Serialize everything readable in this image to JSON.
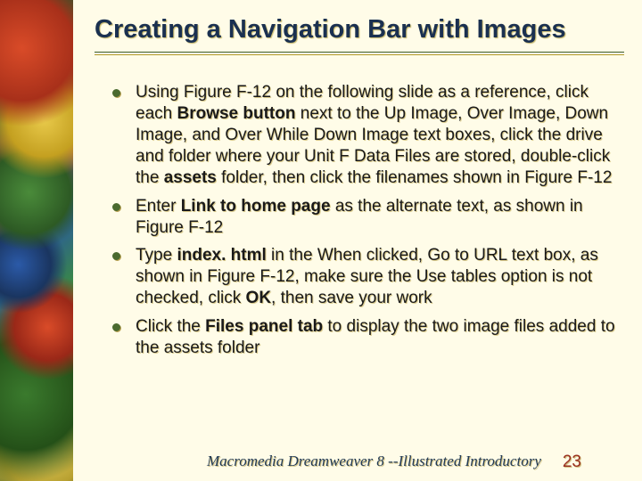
{
  "title": "Creating a Navigation Bar with Images",
  "bullets": [
    {
      "segments": [
        {
          "t": "Using Figure F-12 on the following slide as a reference, click each ",
          "b": false
        },
        {
          "t": "Browse button",
          "b": true
        },
        {
          "t": " next to the Up Image, Over Image, Down Image, and Over While Down Image text boxes, click the drive and folder where your Unit F Data Files are stored, double-click the ",
          "b": false
        },
        {
          "t": "assets",
          "b": true
        },
        {
          "t": " folder, then click the filenames shown in Figure F-12",
          "b": false
        }
      ]
    },
    {
      "segments": [
        {
          "t": "Enter ",
          "b": false
        },
        {
          "t": "Link to home page",
          "b": true
        },
        {
          "t": " as the alternate text, as shown in Figure F-12",
          "b": false
        }
      ]
    },
    {
      "segments": [
        {
          "t": "Type ",
          "b": false
        },
        {
          "t": "index. html",
          "b": true
        },
        {
          "t": " in the When clicked, Go to URL text box, as shown in Figure F-12, make sure the Use tables option is not checked, click ",
          "b": false
        },
        {
          "t": "OK",
          "b": true
        },
        {
          "t": ", then save your work",
          "b": false
        }
      ]
    },
    {
      "segments": [
        {
          "t": "Click the ",
          "b": false
        },
        {
          "t": "Files panel tab",
          "b": true
        },
        {
          "t": " to display the two image files added to the assets folder",
          "b": false
        }
      ]
    }
  ],
  "footer_text": "Macromedia Dreamweaver 8 --Illustrated Introductory",
  "page_number": "23"
}
